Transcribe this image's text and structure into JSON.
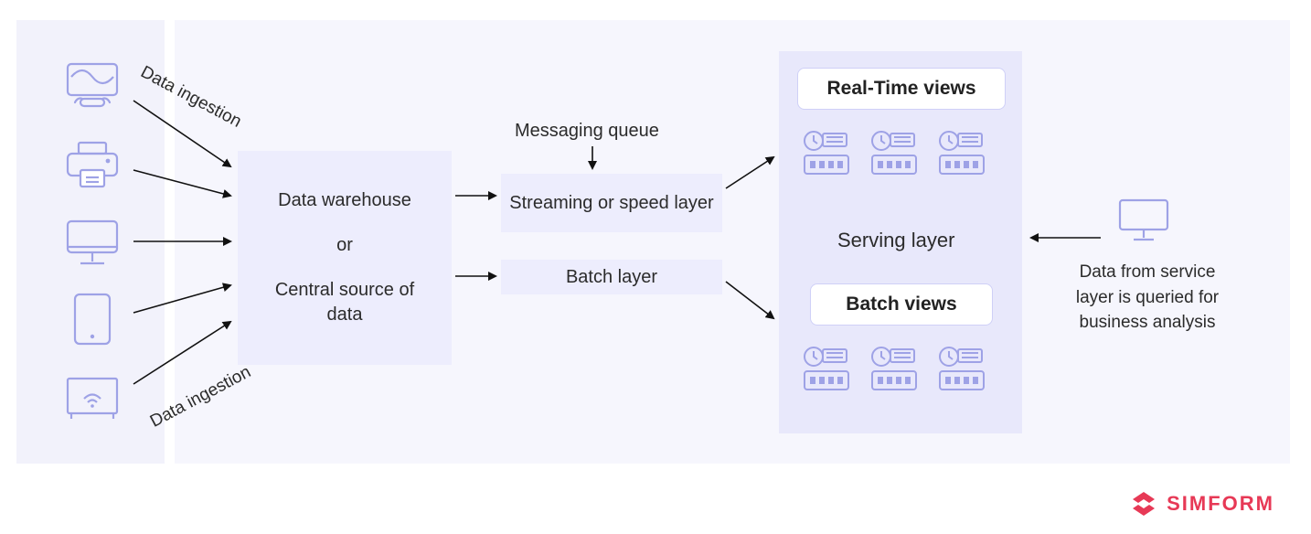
{
  "labels": {
    "data_ingestion_top": "Data ingestion",
    "data_ingestion_bottom": "Data ingestion",
    "messaging_queue": "Messaging queue",
    "serving_layer": "Serving layer",
    "query_description": "Data from service layer is queried for business analysis"
  },
  "nodes": {
    "data_warehouse": "Data warehouse",
    "or": "or",
    "central_source": "Central source of data",
    "streaming_layer": "Streaming or speed layer",
    "batch_layer": "Batch layer",
    "realtime_views": "Real-Time views",
    "batch_views": "Batch views"
  },
  "branding": {
    "company": "SIMFORM"
  },
  "icons": {
    "devices": [
      "router",
      "printer",
      "desktop",
      "tablet",
      "smart-tv"
    ],
    "server_cluster_count": 3,
    "query_client": "desktop"
  },
  "colors": {
    "canvas_bg": "#f6f6fd",
    "left_band": "#f2f2fb",
    "node_bg": "#EDEDFD",
    "serving_bg": "#E8E8FB",
    "pill_border": "#cfd0f7",
    "icon": "#9ea2e6",
    "brand": "#e73956"
  }
}
